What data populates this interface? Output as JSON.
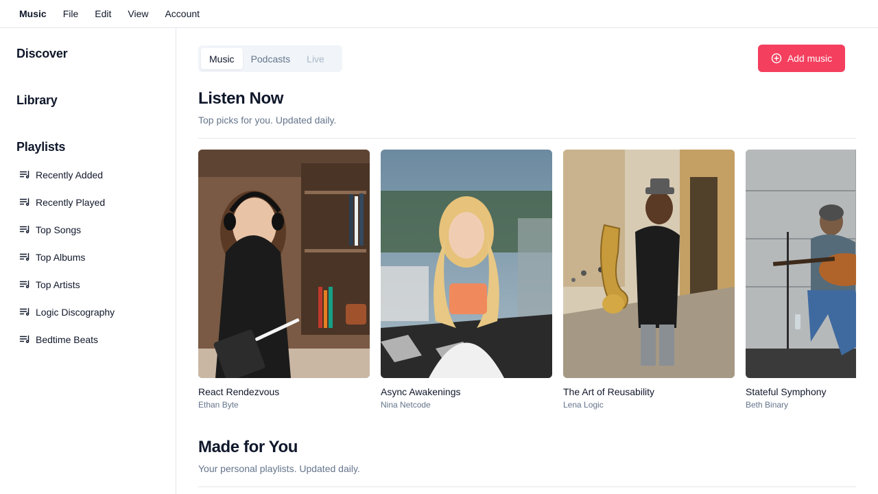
{
  "menubar": {
    "items": [
      "Music",
      "File",
      "Edit",
      "View",
      "Account"
    ]
  },
  "sidebar": {
    "discover": "Discover",
    "library": "Library",
    "playlists_heading": "Playlists",
    "playlists": [
      "Recently Added",
      "Recently Played",
      "Top Songs",
      "Top Albums",
      "Top Artists",
      "Logic Discography",
      "Bedtime Beats"
    ],
    "playlist_icon": "list-music-icon"
  },
  "main": {
    "tabs": [
      {
        "label": "Music",
        "state": "active"
      },
      {
        "label": "Podcasts",
        "state": "inactive"
      },
      {
        "label": "Live",
        "state": "disabled"
      }
    ],
    "add_button": {
      "label": "Add music",
      "icon": "plus-circle-icon",
      "color": "#f43f5e"
    },
    "listen_now": {
      "title": "Listen Now",
      "subtitle": "Top picks for you. Updated daily."
    },
    "albums": [
      {
        "title": "React Rendezvous",
        "artist": "Ethan Byte"
      },
      {
        "title": "Async Awakenings",
        "artist": "Nina Netcode"
      },
      {
        "title": "The Art of Reusability",
        "artist": "Lena Logic"
      },
      {
        "title": "Stateful Symphony",
        "artist": "Beth Binary"
      }
    ],
    "made_for_you": {
      "title": "Made for You",
      "subtitle": "Your personal playlists. Updated daily."
    }
  }
}
